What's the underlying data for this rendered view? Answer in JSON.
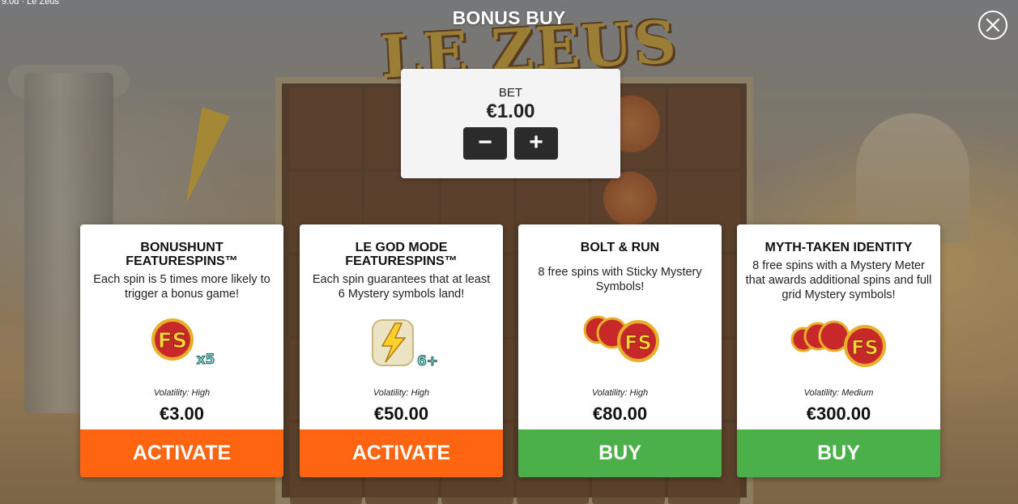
{
  "game": {
    "version_text": "9.0d · Le Zeus",
    "logo_text": "LE ZEUS"
  },
  "modal": {
    "title": "BONUS BUY",
    "close_icon": "close-icon"
  },
  "bet": {
    "label": "BET",
    "value": "€1.00",
    "decrease_label": "−",
    "increase_label": "+"
  },
  "cards": [
    {
      "title": "BONUSHUNT FEATURESPINS™",
      "description": "Each spin is 5 times more likely to trigger a bonus game!",
      "icon": "fs-x5-icon",
      "icon_badge": "x5",
      "volatility": "Volatility: High",
      "price": "€3.00",
      "action": "ACTIVATE",
      "action_color": "#ff6510"
    },
    {
      "title": "LE GOD MODE FEATURESPINS™",
      "description": "Each spin guarantees that at least 6 Mystery symbols land!",
      "icon": "mystery-bolt-icon",
      "icon_badge": "6+",
      "volatility": "Volatility: High",
      "price": "€50.00",
      "action": "ACTIVATE",
      "action_color": "#ff6510"
    },
    {
      "title": "BOLT & RUN",
      "description": "8 free spins with Sticky Mystery Symbols!",
      "icon": "fs-coins-3-icon",
      "volatility": "Volatility: High",
      "price": "€80.00",
      "action": "BUY",
      "action_color": "#4bb049"
    },
    {
      "title": "MYTH-TAKEN IDENTITY",
      "description": "8 free spins with a Mystery Meter that awards additional spins and full grid Mystery symbols!",
      "icon": "fs-coins-4-icon",
      "volatility": "Volatility: Medium",
      "price": "€300.00",
      "action": "BUY",
      "action_color": "#4bb049"
    }
  ]
}
